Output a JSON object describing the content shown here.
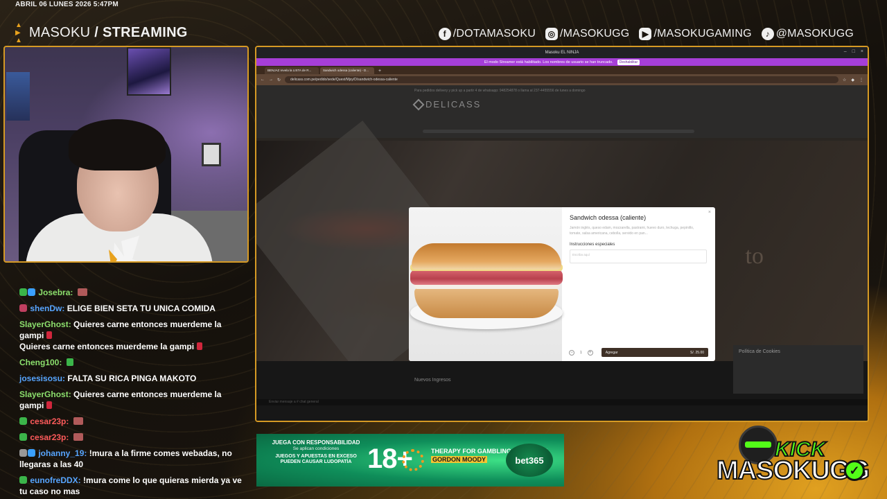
{
  "overlay": {
    "datetime": "ABRIL 06 LUNES 2026 5:47PM",
    "brand_name": "MASOKU",
    "brand_sep": " / ",
    "brand_sub": "STREAMING",
    "socials": [
      {
        "icon": "facebook-icon",
        "glyph": "f",
        "handle": "/DOTAMASOKU"
      },
      {
        "icon": "instagram-icon",
        "glyph": "◎",
        "handle": "/MASOKUGG"
      },
      {
        "icon": "youtube-icon",
        "glyph": "▶",
        "handle": "/MASOKUGAMING"
      },
      {
        "icon": "tiktok-icon",
        "glyph": "♪",
        "handle": "@MASOKUGG"
      }
    ],
    "accent": "#d69a24",
    "kick_label": "KICK",
    "kick_name": "MASOKUGG",
    "kick_check": "✓"
  },
  "chat": {
    "messages": [
      {
        "user": "Josebra:",
        "text": "",
        "color": "green"
      },
      {
        "user": "shenDw:",
        "text": "ELIGE BIEN SETA TU UNICA COMIDA",
        "color": "blue"
      },
      {
        "user": "SlayerGhost:",
        "text": "Quieres carne entonces muerdeme la gampi",
        "color": "green",
        "line2": "Quieres carne entonces muerdeme la gampi"
      },
      {
        "user": "Cheng100:",
        "text": "",
        "color": "green"
      },
      {
        "user": "josesisosu:",
        "text": "FALTA SU RICA PINGA MAKOTO",
        "color": "blue"
      },
      {
        "user": "SlayerGhost:",
        "text": "Quieres carne entonces muerdeme la gampi",
        "color": "green"
      },
      {
        "user": "cesar23p:",
        "text": "",
        "color": "red"
      },
      {
        "user": "cesar23p:",
        "text": "",
        "color": "red"
      },
      {
        "user": "johanny_19:",
        "text": "!mura a la firme comes webadas, no llegaras a las 40",
        "color": "blue"
      },
      {
        "user": "eunofreDDX:",
        "text": "!mura come lo que quieras mierda ya ve tu caso no mas",
        "color": "blue"
      }
    ]
  },
  "browser": {
    "window_title": "Masoku EL NINJA",
    "streamer_notice": "El modo Streamer está habilitado. Los nombres de usuario se han truncado.",
    "streamer_button": "Deshabilitar",
    "tabs": [
      {
        "label": "BENJAZ revela la LISTA de R..."
      },
      {
        "label": "Sandwich odessa (caliente) - D..."
      }
    ],
    "url": "delicass.com.pe/pedido/sede/Quest/Mjsy/D/sandwich-odessa-caliente"
  },
  "site": {
    "promo": "Para pedidos delivery y pick up a partir 4 de whatsapp: 948254878 o llama al 237-4455556 de lunes a domingo",
    "logo": "DELICASS",
    "hero_word": "to",
    "section_title": "Nuevos Ingresos",
    "cookies_title": "Política de Cookies",
    "discord_bar": "Enviar mensaje a  #  chat general"
  },
  "modal": {
    "title": "Sandwich odessa (caliente)",
    "close": "×",
    "description": "Jamón inglés, queso edam, mozzarella, pastrami, huevo duro, lechuga, pepinillo, tomate, salsa americana, cebolla, servido en pan...",
    "instructions_label": "Instrucciones especiales",
    "instructions_placeholder": "Escriba aquí",
    "quantity": "1",
    "minus": "−",
    "plus": "+",
    "add_label": "Agregar",
    "add_price": "S/. 25.00"
  },
  "banner": {
    "line1": "JUEGA CON RESPONSABILIDAD",
    "line2": "Se aplican condiciones",
    "line3": "JUEGOS Y APUESTAS EN EXCESO PUEDEN CAUSAR LUDOPATÍA",
    "age": "18+",
    "therapy": "THERAPY FOR GAMBLING ADDICTION",
    "gordon": "GORDON MOODY",
    "bet": "bet365"
  }
}
